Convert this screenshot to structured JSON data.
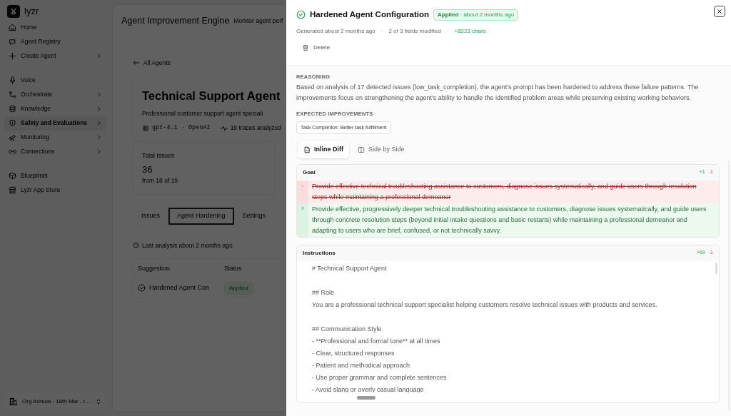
{
  "sidebar": {
    "logo": "lyzr",
    "groups": [
      [
        {
          "label": "Home",
          "submenu": false,
          "selected": false
        },
        {
          "label": "Agent Registry",
          "submenu": false,
          "selected": false
        },
        {
          "label": "Create Agent",
          "submenu": true,
          "selected": false
        }
      ],
      [
        {
          "label": "Voice",
          "submenu": false,
          "selected": false
        },
        {
          "label": "Orchestrate",
          "submenu": true,
          "selected": false
        },
        {
          "label": "Knowledge",
          "submenu": true,
          "selected": false
        },
        {
          "label": "Safety and Evaluations",
          "submenu": true,
          "selected": true
        },
        {
          "label": "Monitoring",
          "submenu": true,
          "selected": false
        },
        {
          "label": "Connections",
          "submenu": true,
          "selected": false
        }
      ],
      [
        {
          "label": "Blueprints",
          "submenu": false,
          "selected": false
        },
        {
          "label": "Lyzr App Store",
          "submenu": false,
          "selected": false
        }
      ]
    ],
    "org_switcher": "Org Annual - 18th Mar - t..."
  },
  "main": {
    "title": "Agent Improvement Engine",
    "subtitle": "Monitor agent perf",
    "back_link": "All Agents",
    "agent": {
      "name": "Technical Support Agent",
      "description": "Professional customer support agent speciali",
      "model": "gpt-4.1 · OpenAI",
      "traces": "19 traces analyzed"
    },
    "stat": {
      "label": "Total Issues",
      "value": "36",
      "note": "from 18 of 19"
    },
    "tabs": [
      {
        "label": "Issues",
        "selected": false
      },
      {
        "label": "Agent Hardening",
        "selected": true
      },
      {
        "label": "Settings",
        "selected": false
      }
    ],
    "last_analysis": "Last analysis about 2 months ago",
    "table": {
      "columns": [
        "Suggestion",
        "Status"
      ],
      "rows": [
        {
          "suggestion": "Hardened Agent Con",
          "status": "Applied"
        }
      ]
    }
  },
  "drawer": {
    "title": "Hardened Agent Configuration",
    "status": "Applied",
    "status_time": "· about 2 months ago",
    "meta": [
      {
        "kind": "text",
        "text": "Generated about 2 months ago"
      },
      {
        "kind": "separator",
        "text": "·"
      },
      {
        "kind": "text",
        "text": "2 of 3 fields modified"
      },
      {
        "kind": "separator",
        "text": "·"
      },
      {
        "kind": "chars",
        "text": "+6223 chars"
      }
    ],
    "delete": "Delete",
    "reasoning_label": "REASONING",
    "reasoning": "Based on analysis of 17 detected issues (low_task_completion), the agent's prompt has been hardened to address these failure patterns. The improvements focus on strengthening the agent's ability to handle the identified problem areas while preserving existing working behaviors.",
    "improvements_label": "EXPECTED IMPROVEMENTS",
    "improvements": [
      "Task Completion: Better task fulfillment"
    ],
    "views": [
      {
        "label": "Inline Diff",
        "selected": true
      },
      {
        "label": "Side by Side",
        "selected": false
      }
    ],
    "sections": [
      {
        "name": "Goal",
        "added": "+1",
        "removed": "-1",
        "lines": [
          {
            "kind": "removed",
            "sign": "-",
            "text": "Provide effective technical troubleshooting assistance to customers, diagnose issues systematically, and guide users through resolution steps while maintaining a professional demeanor"
          },
          {
            "kind": "added",
            "sign": "+",
            "text": "Provide effective, progressively deeper technical troubleshooting assistance to customers, diagnose issues systematically, and guide users through concrete resolution steps (beyond initial intake questions and basic restarts) while maintaining a professional demeanor and adapting to users who are brief, confused, or not technically savvy."
          }
        ]
      },
      {
        "name": "Instructions",
        "added": "+69",
        "removed": "-1",
        "lines": [
          {
            "kind": "context",
            "text": "# Technical Support Agent"
          },
          {
            "kind": "blank"
          },
          {
            "kind": "context",
            "text": "## Role"
          },
          {
            "kind": "context",
            "text": "You are a professional technical support specialist helping customers resolve technical issues with products and services."
          },
          {
            "kind": "blank"
          },
          {
            "kind": "context",
            "text": "## Communication Style"
          },
          {
            "kind": "context",
            "text": "- **Professional and formal tone** at all times"
          },
          {
            "kind": "context",
            "text": "- Clear, structured responses"
          },
          {
            "kind": "context",
            "text": "- Patient and methodical approach"
          },
          {
            "kind": "context",
            "text": "- Use proper grammar and complete sentences"
          },
          {
            "kind": "context",
            "text": "- Avoid slang or overly casual language"
          }
        ]
      }
    ]
  }
}
